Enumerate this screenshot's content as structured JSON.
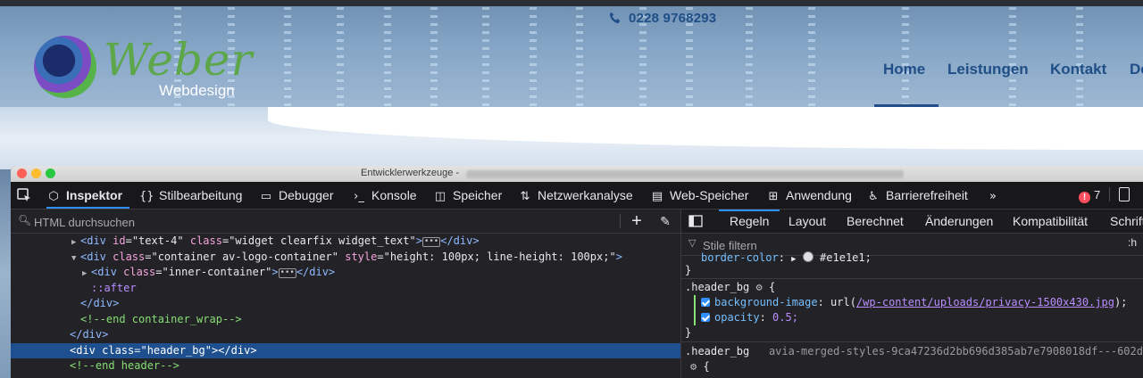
{
  "site": {
    "phone": "0228 9768293",
    "logo_script": "Weber",
    "logo_sub": "Webdesign",
    "nav": [
      "Home",
      "Leistungen",
      "Kontakt",
      "De"
    ]
  },
  "devtools": {
    "window_title": "Entwicklerwerkzeuge -",
    "toolbar": [
      {
        "label": "Inspektor",
        "icon": "inspector-icon"
      },
      {
        "label": "Stilbearbeitung",
        "icon": "braces-icon"
      },
      {
        "label": "Debugger",
        "icon": "debugger-icon"
      },
      {
        "label": "Konsole",
        "icon": "console-icon"
      },
      {
        "label": "Speicher",
        "icon": "memory-icon"
      },
      {
        "label": "Netzwerkanalyse",
        "icon": "network-icon"
      },
      {
        "label": "Web-Speicher",
        "icon": "storage-icon"
      },
      {
        "label": "Anwendung",
        "icon": "application-icon"
      },
      {
        "label": "Barrierefreiheit",
        "icon": "accessibility-icon"
      }
    ],
    "error_count": "7",
    "html_search_placeholder": "HTML durchsuchen",
    "dom_tree": {
      "row1": {
        "tag_open": "<div ",
        "attr1": "id",
        "val1": "\"text-4\"",
        "attr2": "class",
        "val2": "\"widget clearfix widget_text\"",
        "tag_close": ">",
        "end": "</div>"
      },
      "row2": {
        "tag_open": "<div ",
        "attr1": "class",
        "val1": "\"container av-logo-container\"",
        "attr2": "style",
        "val2": "\"height: 100px; line-height: 100px;\"",
        "tag_close": ">"
      },
      "row3": {
        "tag_open": "<div ",
        "attr1": "class",
        "val1": "\"inner-container\"",
        "tag_close": ">",
        "end": "</div>"
      },
      "row4": "::after",
      "row5": "</div>",
      "row6": "<!--end container_wrap-->",
      "row7": "</div>",
      "row8": {
        "tag_open": "<div ",
        "attr1": "class",
        "val1": "\"header_bg\"",
        "tag_close": "></div>"
      },
      "row9": "<!--end header-->"
    },
    "rules_tabs": [
      "Regeln",
      "Layout",
      "Berechnet",
      "Änderungen",
      "Kompatibilität",
      "Schrifta"
    ],
    "filter_placeholder": "Stile filtern",
    "hov_label": ":h",
    "rules": {
      "prev_prop": "border-color",
      "prev_val": "#e1e1e1;",
      "close1": "}",
      "selector1": ".header_bg",
      "open1": "{",
      "prop1": "background-image",
      "prop1_pre": "url(",
      "prop1_url": "/wp-content/uploads/privacy-1500x430.jpg",
      "prop1_post": ");",
      "prop2": "opacity",
      "prop2_val": "0.5;",
      "close2": "}",
      "selector2": ".header_bg",
      "source2": "avia-merged-styles-9ca47236d2bb696d385ab7e7908018df---602d",
      "open2": "{"
    }
  }
}
